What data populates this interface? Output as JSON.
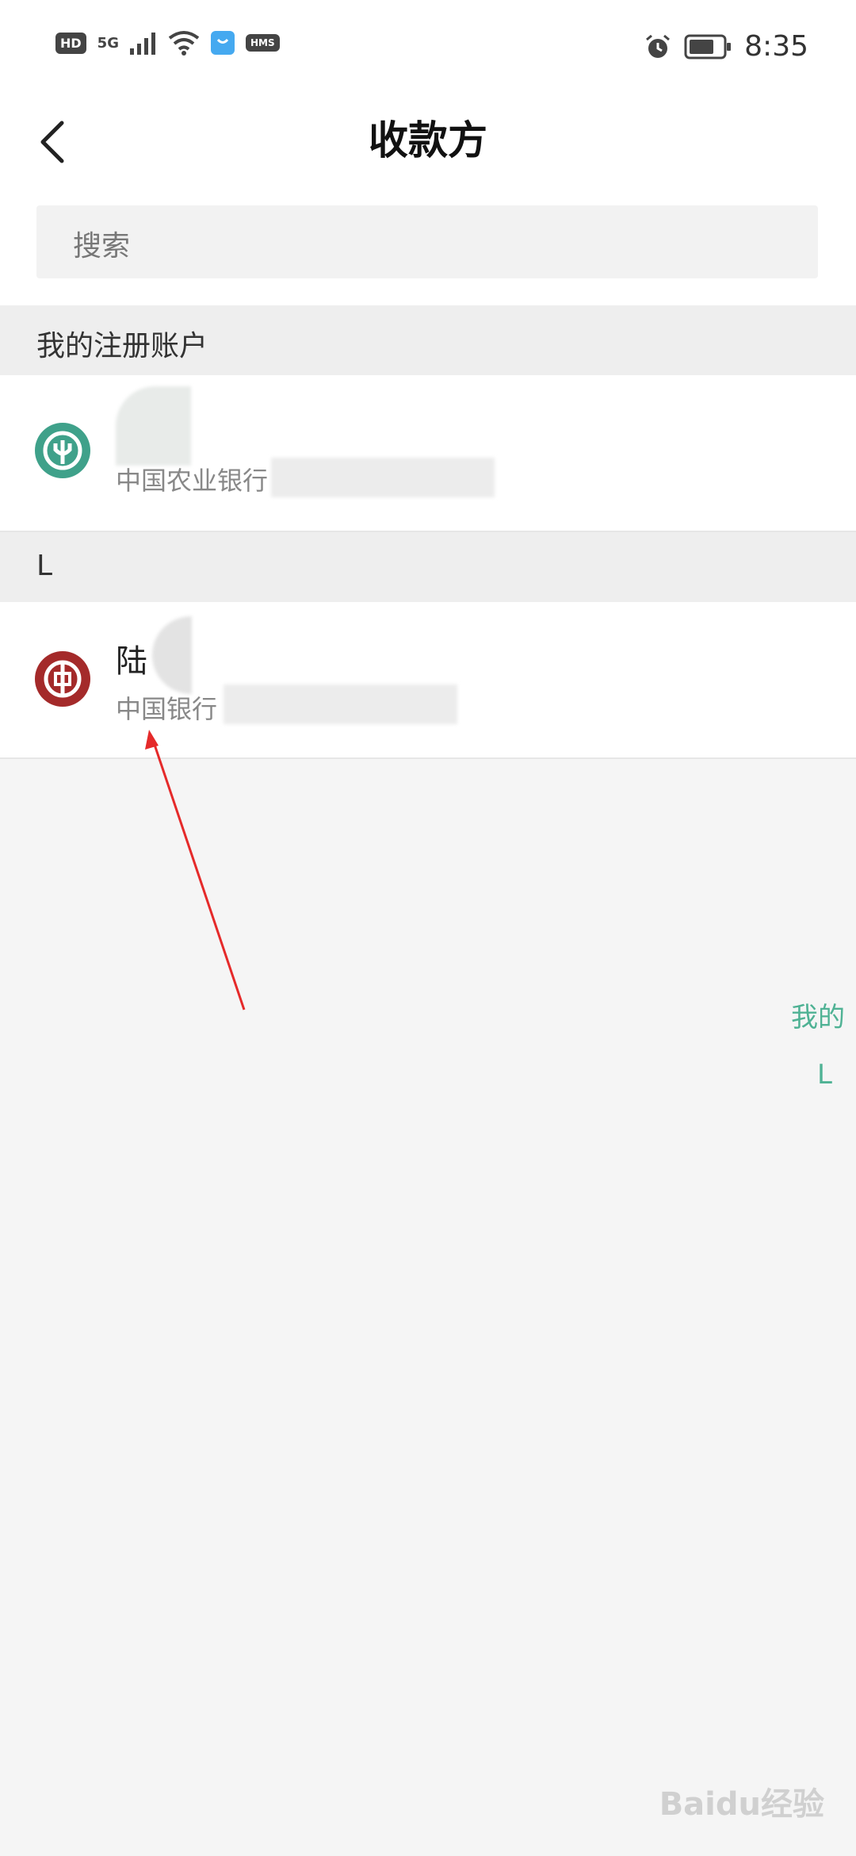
{
  "status_bar": {
    "hd": "HD",
    "network": "5G",
    "hms": "HMS",
    "time": "8:35"
  },
  "header": {
    "title": "收款方"
  },
  "search": {
    "placeholder": "搜索"
  },
  "sections": [
    {
      "label": "我的注册账户"
    },
    {
      "label": "L"
    }
  ],
  "payees": [
    {
      "name": "",
      "bank": "中国农业银行",
      "icon_color": "#3fa18a"
    },
    {
      "name": "陆",
      "bank": "中国银行",
      "icon_color": "#a42a2a"
    }
  ],
  "index_bar": {
    "items": [
      "我的",
      "L"
    ]
  },
  "watermark": "Baidu经验"
}
